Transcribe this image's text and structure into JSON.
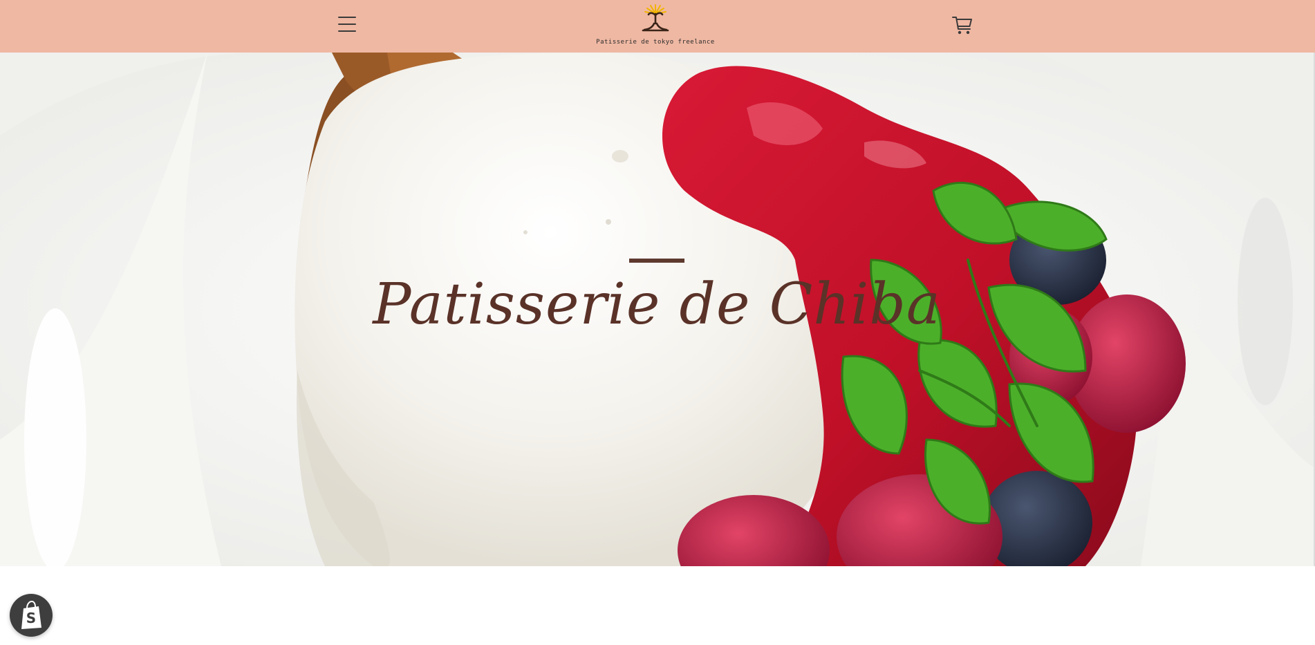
{
  "header": {
    "logo_text": "Patisserie de tokyo freelance",
    "menu_icon": "hamburger-menu-icon",
    "logo_icon": "tree-logo-icon",
    "cart_icon": "shopping-cart-icon",
    "background_color": "#efb8a3"
  },
  "hero": {
    "title": "Patisserie de Chiba",
    "image_subject": "panna-cotta-with-berry-sauce-mint-raspberries-blueberries",
    "accent_color": "#5e3a2e"
  },
  "floating": {
    "shopify_icon": "shopify-bag-icon",
    "shopify_label": "S"
  }
}
